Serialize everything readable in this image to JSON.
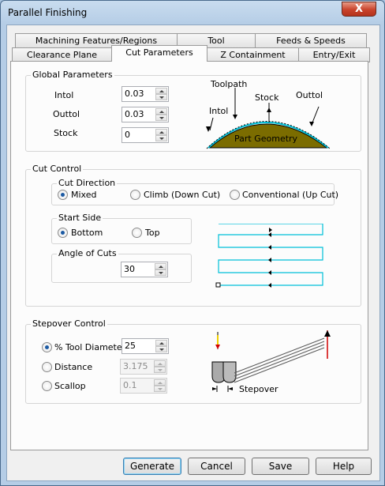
{
  "window": {
    "title": "Parallel Finishing",
    "close_glyph": "X"
  },
  "tabs": {
    "row1": [
      "Machining Features/Regions",
      "Tool",
      "Feeds & Speeds"
    ],
    "row2": [
      "Clearance Plane",
      "Cut Parameters",
      "Z Containment",
      "Entry/Exit"
    ],
    "active": "Cut Parameters"
  },
  "global_parameters": {
    "title": "Global Parameters",
    "intol_label": "Intol",
    "intol_value": "0.03",
    "outtol_label": "Outtol",
    "outtol_value": "0.03",
    "stock_label": "Stock",
    "stock_value": "0",
    "diagram": {
      "toolpath": "Toolpath",
      "stock": "Stock",
      "outtol": "Outtol",
      "intol": "Intol",
      "part": "Part Geometry"
    }
  },
  "cut_control": {
    "title": "Cut Control",
    "cut_direction": {
      "title": "Cut Direction",
      "mixed": "Mixed",
      "climb": "Climb (Down Cut)",
      "conventional": "Conventional (Up Cut)",
      "selected": "Mixed"
    },
    "start_side": {
      "title": "Start Side",
      "bottom": "Bottom",
      "top": "Top",
      "selected": "Bottom"
    },
    "angle": {
      "title": "Angle of Cuts",
      "value": "30"
    }
  },
  "stepover_control": {
    "title": "Stepover Control",
    "tool_diameter_label": "% Tool Diameter",
    "tool_diameter_value": "25",
    "distance_label": "Distance",
    "distance_value": "3.175",
    "scallop_label": "Scallop",
    "scallop_value": "0.1",
    "selected": "% Tool Diameter",
    "diagram_label": "Stepover"
  },
  "buttons": {
    "generate": "Generate",
    "cancel": "Cancel",
    "save": "Save",
    "help": "Help"
  },
  "colors": {
    "part_fill": "#7b6c00",
    "toolpath": "#00c0d8",
    "arrow_red": "#d00000",
    "tool_yellow": "#f0d000"
  }
}
